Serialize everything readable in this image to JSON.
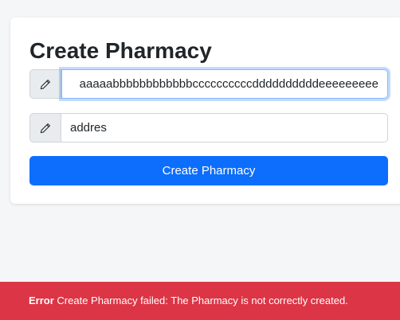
{
  "form": {
    "title": "Create Pharmacy",
    "name_field": {
      "value": "aaaaabbbbbbbbbbbbccccccccccddddddddddeeeeeeeee",
      "icon": "pencil-icon"
    },
    "address_field": {
      "value": "addres",
      "icon": "pencil-icon"
    },
    "submit_label": "Create Pharmacy"
  },
  "toast": {
    "label": "Error",
    "message": "Create Pharmacy failed: The Pharmacy is not correctly created."
  },
  "colors": {
    "primary": "#0d6efd",
    "danger": "#dc3545",
    "focus_border": "#86b7fe"
  }
}
